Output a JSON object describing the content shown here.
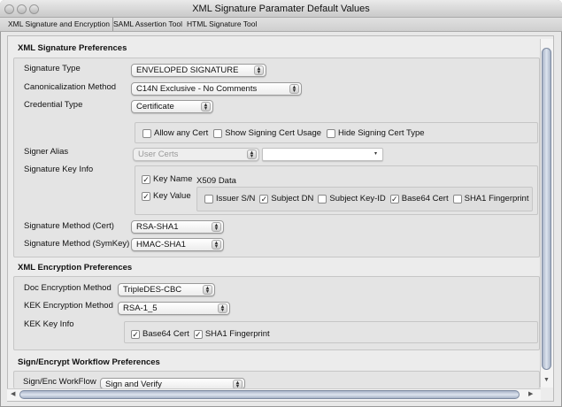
{
  "window": {
    "title": "XML Signature Paramater Default Values"
  },
  "tabs": [
    "XML Signature and Encryption",
    "SAML Assertion Tool",
    "HTML Signature Tool"
  ],
  "signature": {
    "heading": "XML Signature Preferences",
    "signature_type_label": "Signature Type",
    "signature_type": "ENVELOPED SIGNATURE",
    "canon_label": "Canonicalization Method",
    "canon": "C14N Exclusive - No Comments",
    "credential_label": "Credential Type",
    "credential": "Certificate",
    "allow_any_cert": "Allow any Cert",
    "show_usage": "Show Signing Cert Usage",
    "hide_type": "Hide Signing Cert Type",
    "signer_alias_label": "Signer Alias",
    "signer_store": "User Certs",
    "signer_alias": "",
    "key_info_label": "Signature Key Info",
    "key_name": "Key Name",
    "x509": "X509 Data",
    "key_value": "Key Value",
    "issuer": "Issuer S/N",
    "subject_dn": "Subject DN",
    "subject_key": "Subject Key-ID",
    "base64": "Base64 Cert",
    "sha1": "SHA1 Fingerprint",
    "method_cert_label": "Signature Method (Cert)",
    "method_cert": "RSA-SHA1",
    "method_sym_label": "Signature Method (SymKey)",
    "method_sym": "HMAC-SHA1"
  },
  "encryption": {
    "heading": "XML Encryption Preferences",
    "doc_label": "Doc Encryption Method",
    "doc": "TripleDES-CBC",
    "kek_label": "KEK Encryption Method",
    "kek": "RSA-1_5",
    "kek_info_label": "KEK Key Info",
    "base64": "Base64 Cert",
    "sha1": "SHA1 Fingerprint"
  },
  "workflow": {
    "heading": "Sign/Encrypt Workflow Preferences",
    "label": "Sign/Enc WorkFlow",
    "value": "Sign and Verify"
  }
}
